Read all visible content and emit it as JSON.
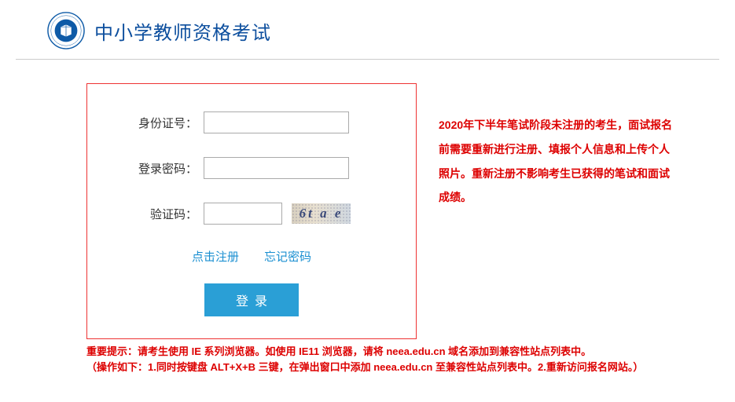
{
  "header": {
    "title": "中小学教师资格考试"
  },
  "form": {
    "id_label": "身份证号：",
    "password_label": "登录密码：",
    "captcha_label": "验证码：",
    "captcha_text": "6t a e",
    "id_value": "",
    "password_value": "",
    "captcha_value": ""
  },
  "links": {
    "register": "点击注册",
    "forgot": "忘记密码"
  },
  "buttons": {
    "login": "登录"
  },
  "notices": {
    "side": "2020年下半年笔试阶段未注册的考生，面试报名前需要重新进行注册、填报个人信息和上传个人照片。重新注册不影响考生已获得的笔试和面试成绩。",
    "bottom1": "重要提示：请考生使用 IE 系列浏览器。如使用 IE11 浏览器，请将 neea.edu.cn 域名添加到兼容性站点列表中。",
    "bottom2": "（操作如下：1.同时按键盘 ALT+X+B 三键，在弹出窗口中添加 neea.edu.cn 至兼容性站点列表中。2.重新访问报名网站。）"
  },
  "colors": {
    "brand": "#0d4f9e",
    "link": "#1a8fd1",
    "button": "#2a9fd6",
    "alert": "#d00",
    "border_alert": "#e33"
  }
}
